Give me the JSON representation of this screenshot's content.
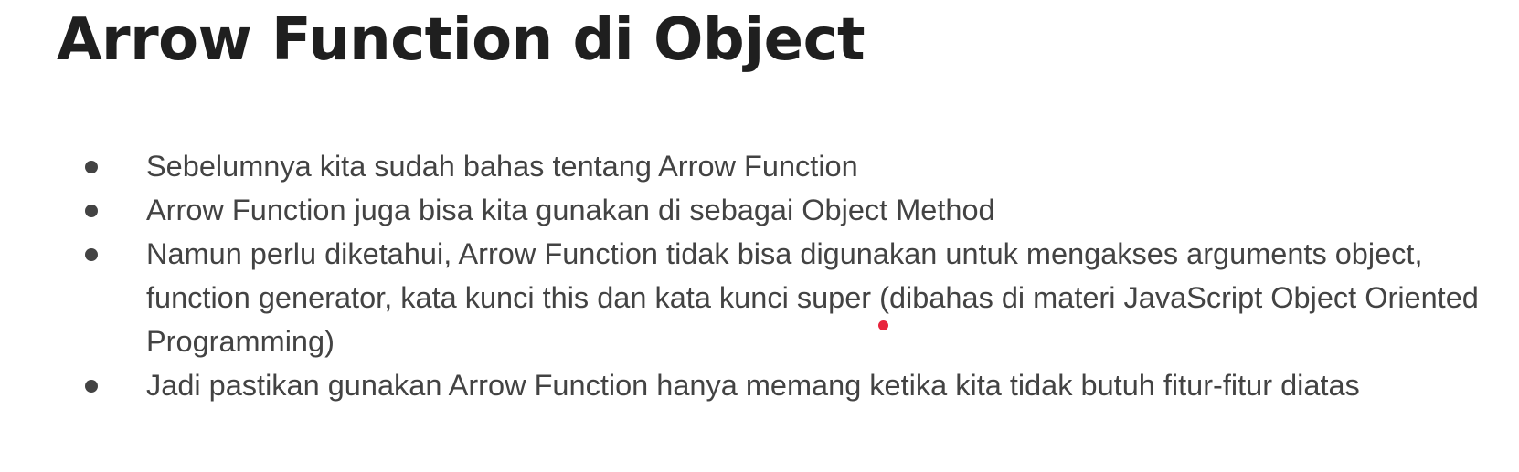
{
  "slide": {
    "title": "Arrow Function di Object",
    "bullets": [
      "Sebelumnya kita sudah bahas tentang Arrow Function",
      "Arrow Function juga bisa kita gunakan di sebagai Object Method",
      "Namun perlu diketahui, Arrow Function tidak bisa digunakan untuk mengakses arguments object, function generator, kata kunci this dan kata kunci super (dibahas di materi JavaScript Object Oriented Programming)",
      "Jadi pastikan gunakan Arrow Function hanya memang ketika kita tidak butuh fitur-fitur diatas"
    ]
  },
  "colors": {
    "title": "#1f1f1f",
    "body_text": "#434343",
    "pointer": "#e8243c",
    "background": "#ffffff"
  },
  "icons": {
    "bullet": "bullet-dot-icon",
    "pointer": "laser-pointer-icon"
  }
}
